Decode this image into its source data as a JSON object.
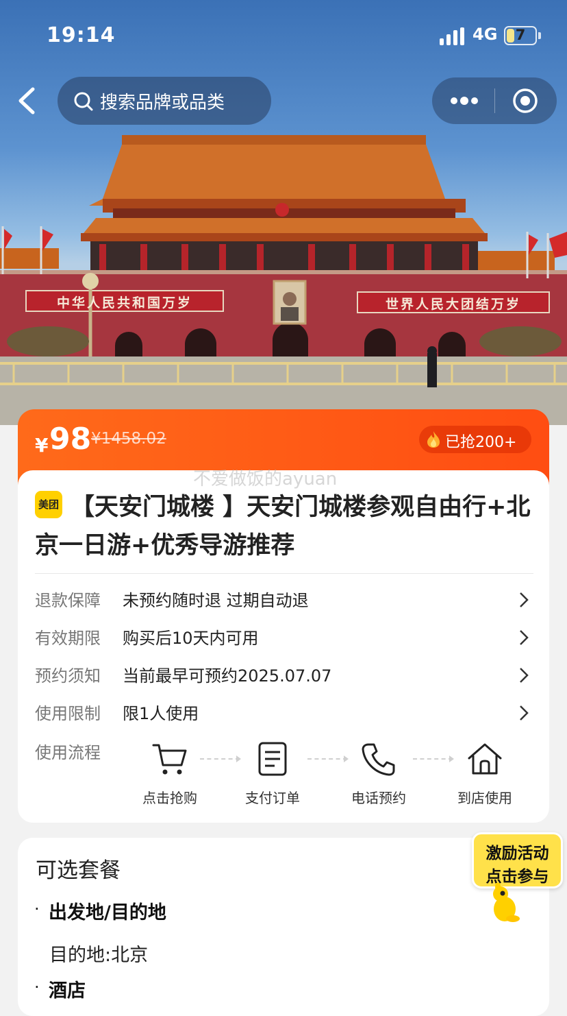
{
  "status": {
    "time": "19:14",
    "network": "4G",
    "battery": "7",
    "battery_level": 0.07
  },
  "nav": {
    "search_placeholder": "搜索品牌或品类"
  },
  "hero": {
    "banner_left": "中华人民共和国万岁",
    "banner_right": "世界人民大团结万岁"
  },
  "price": {
    "currency": "¥",
    "current": "98",
    "original": "¥1458.02",
    "sold": "已抢200+"
  },
  "watermark": "不爱做饭的ayuan",
  "product": {
    "brand_badge": "美团",
    "title": "【天安门城楼 】天安门城楼参观自由行+北京一日游+优秀导游推荐"
  },
  "info_rows": [
    {
      "key": "退款保障",
      "value": "未预约随时退 过期自动退"
    },
    {
      "key": "有效期限",
      "value": "购买后10天内可用"
    },
    {
      "key": "预约须知",
      "value": "当前最早可预约2025.07.07"
    },
    {
      "key": "使用限制",
      "value": "限1人使用"
    }
  ],
  "flow": {
    "label": "使用流程",
    "steps": [
      {
        "label": "点击抢购",
        "icon": "cart-icon"
      },
      {
        "label": "支付订单",
        "icon": "document-icon"
      },
      {
        "label": "电话预约",
        "icon": "phone-icon"
      },
      {
        "label": "到店使用",
        "icon": "home-icon"
      }
    ]
  },
  "packages": {
    "heading": "可选套餐",
    "bullet": "·",
    "section1_title": "出发地/目的地",
    "section1_value": "目的地:北京",
    "section2_title": "酒店"
  },
  "promo": {
    "line1": "激励活动",
    "line2": "点击参与"
  },
  "colors": {
    "accent": "#ff5415",
    "brand_yellow": "#ffd000"
  }
}
